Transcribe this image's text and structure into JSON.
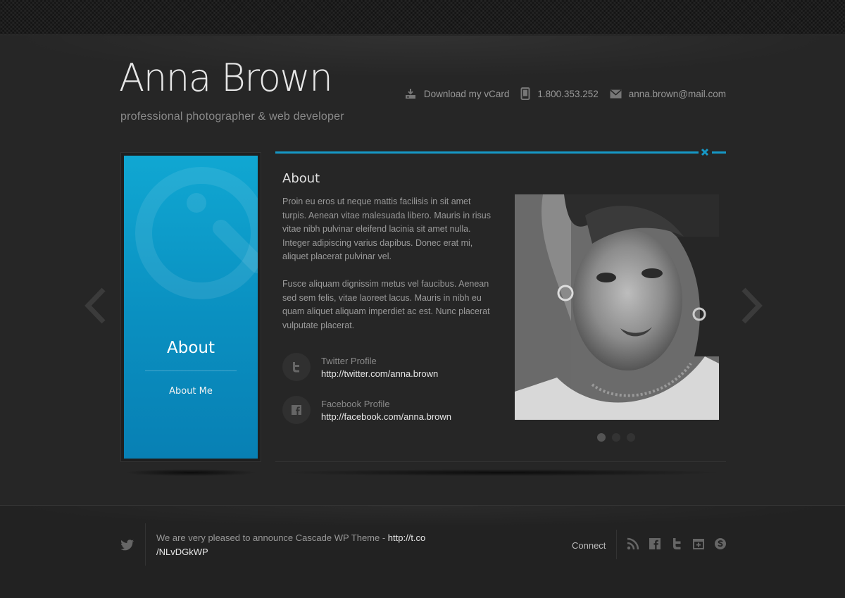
{
  "header": {
    "name": "Anna Brown",
    "tagline": "professional photographer & web developer",
    "contacts": {
      "vcard": "Download my vCard",
      "phone": "1.800.353.252",
      "email": "anna.brown@mail.com"
    }
  },
  "sidebar": {
    "title": "About",
    "link": "About Me",
    "accent_color": "#0a8fc0"
  },
  "about": {
    "heading": "About",
    "paragraph1": "Proin eu eros ut neque mattis facilisis in sit amet turpis. Aenean vitae malesuada libero. Mauris in risus vitae nibh pulvinar eleifend lacinia sit amet nulla. Integer adipiscing varius dapibus. Donec erat mi, aliquet placerat pulvinar vel.",
    "paragraph2": "Fusce aliquam dignissim metus vel faucibus. Aenean sed sem felis, vitae laoreet lacus. Mauris in nibh eu quam aliquet aliquam imperdiet ac est. Nunc placerat vulputate placerat.",
    "social": [
      {
        "label": "Twitter Profile",
        "url": "http://twitter.com/anna.brown",
        "icon": "twitter-icon"
      },
      {
        "label": "Facebook Profile",
        "url": "http://facebook.com/anna.brown",
        "icon": "facebook-icon"
      }
    ]
  },
  "slider": {
    "dots": 3,
    "active_index": 0
  },
  "footer": {
    "tweet_text": "We are very pleased to announce Cascade WP Theme - ",
    "tweet_link_1": "http://t.co",
    "tweet_link_2": "/NLvDGkWP",
    "connect_label": "Connect",
    "icons": [
      "rss-icon",
      "facebook-icon",
      "twitter-icon",
      "calendar-icon",
      "skype-icon"
    ]
  },
  "colors": {
    "accent": "#1698c6",
    "background": "#262626"
  }
}
